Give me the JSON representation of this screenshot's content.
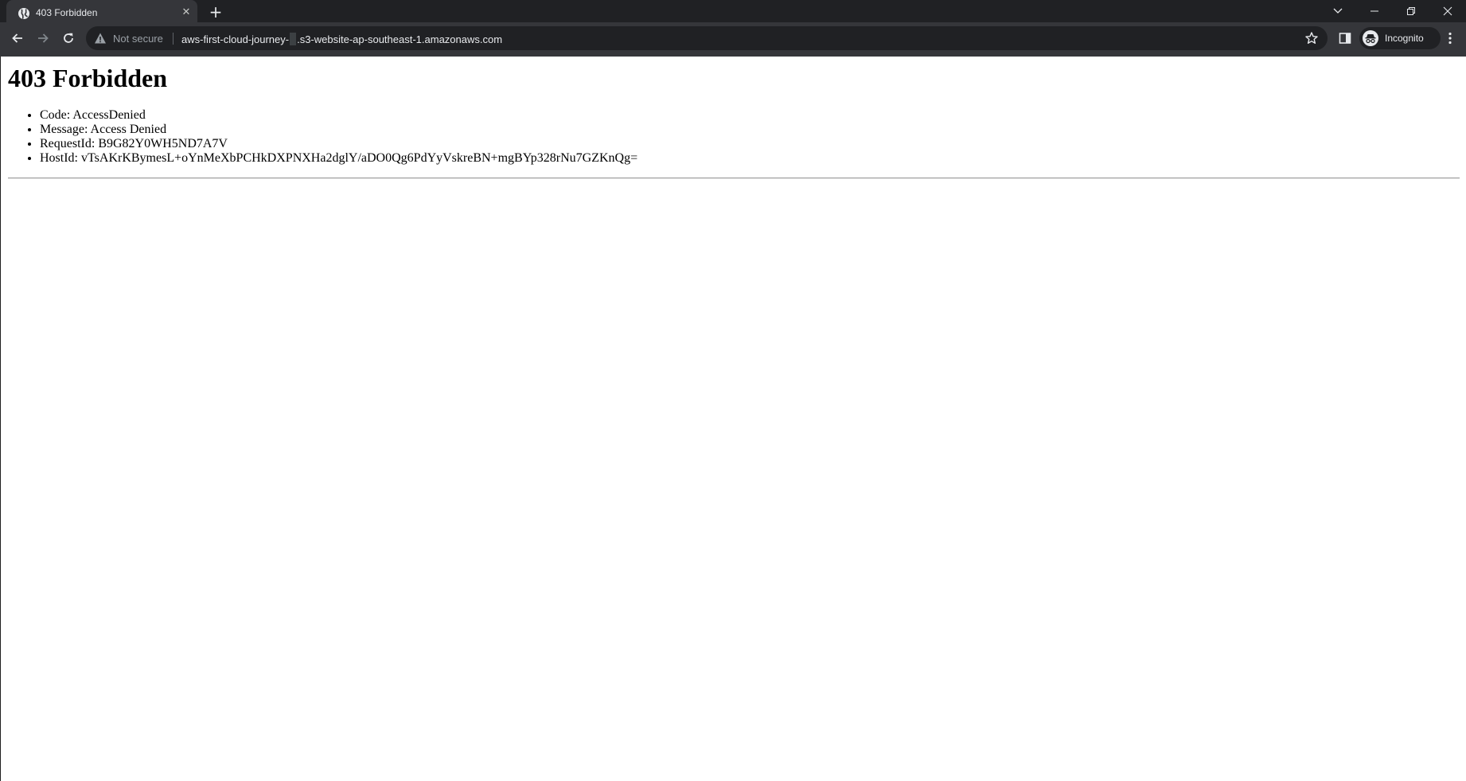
{
  "browser": {
    "tab": {
      "title": "403 Forbidden"
    },
    "omnibox": {
      "security_label": "Not secure",
      "url_part_1": "aws-first-cloud-journey-",
      "url_part_2": ".s3-website-ap-southeast-1.amazonaws.com"
    },
    "profile": {
      "label": "Incognito"
    }
  },
  "page": {
    "heading": "403 Forbidden",
    "details": [
      "Code: AccessDenied",
      "Message: Access Denied",
      "RequestId: B9G82Y0WH5ND7A7V",
      "HostId: vTsAKrKBymesL+oYnMeXbPCHkDXPNXHa2dglY/aDO0Qg6PdYyVskreBN+mgBYp328rNu7GZKnQg="
    ]
  },
  "colors": {
    "tabstrip_bg": "#202124",
    "toolbar_bg": "#35363a",
    "omnibox_bg": "#202124",
    "text_light": "#e8eaed",
    "text_muted": "#9aa0a6"
  }
}
